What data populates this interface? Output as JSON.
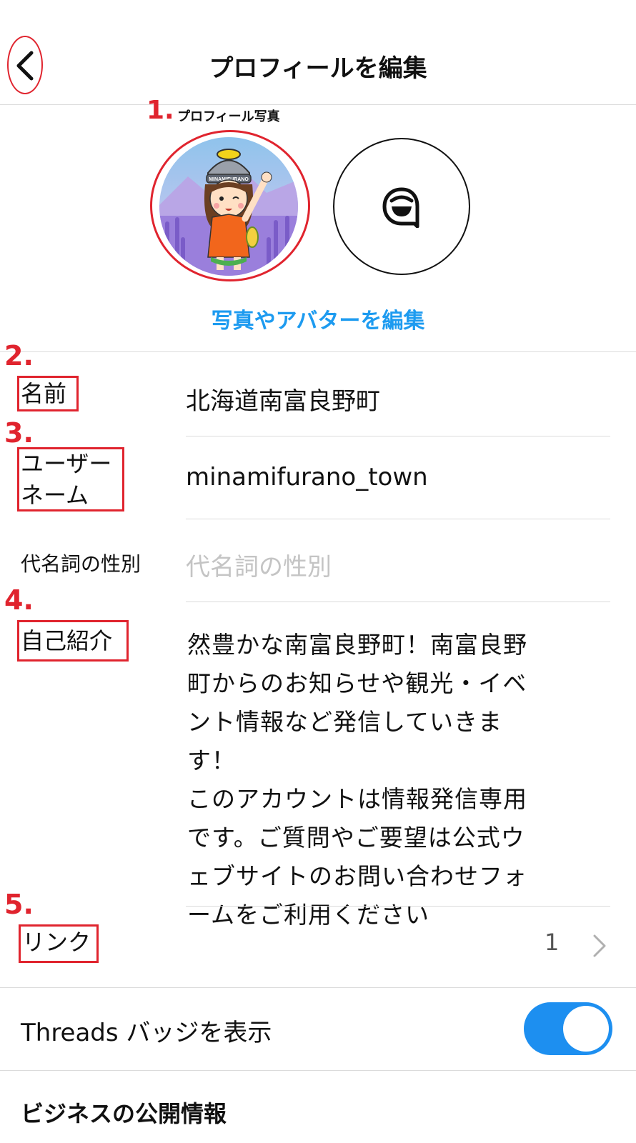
{
  "header": {
    "title": "プロフィールを編集",
    "back_icon": "chevron-left-icon"
  },
  "annotations": {
    "m1": "1.",
    "m2": "2.",
    "m3": "3.",
    "m4": "4.",
    "m5": "5."
  },
  "photo": {
    "caption": "プロフィール写真",
    "edit_label": "写真やアバターを編集",
    "avatar_text": "MINAMIFURANO"
  },
  "fields": {
    "name": {
      "label": "名前",
      "value": "北海道南富良野町"
    },
    "username": {
      "label_line1": "ユーザー",
      "label_line2": "ネーム",
      "value": "minamifurano_town"
    },
    "pronouns": {
      "label": "代名詞の性別",
      "placeholder": "代名詞の性別"
    },
    "bio": {
      "label": "自己紹介",
      "lines": [
        "然豊かな南富良野町！南富良野",
        "町からのお知らせや観光・イベ",
        "ント情報など発信していきま",
        "す！",
        "このアカウントは情報発信専用",
        "です。ご質問やご要望は公式ウ",
        "ェブサイトのお問い合わせフォ",
        "ームをご利用ください"
      ]
    },
    "links": {
      "label": "リンク",
      "count": "1"
    }
  },
  "threads": {
    "label": "Threads バッジを表示",
    "enabled": true,
    "accent": "#1d8ff0"
  },
  "business": {
    "title": "ビジネスの公開情報"
  },
  "colors": {
    "annotation_red": "#e0242e",
    "link_blue": "#1d9bf0"
  }
}
